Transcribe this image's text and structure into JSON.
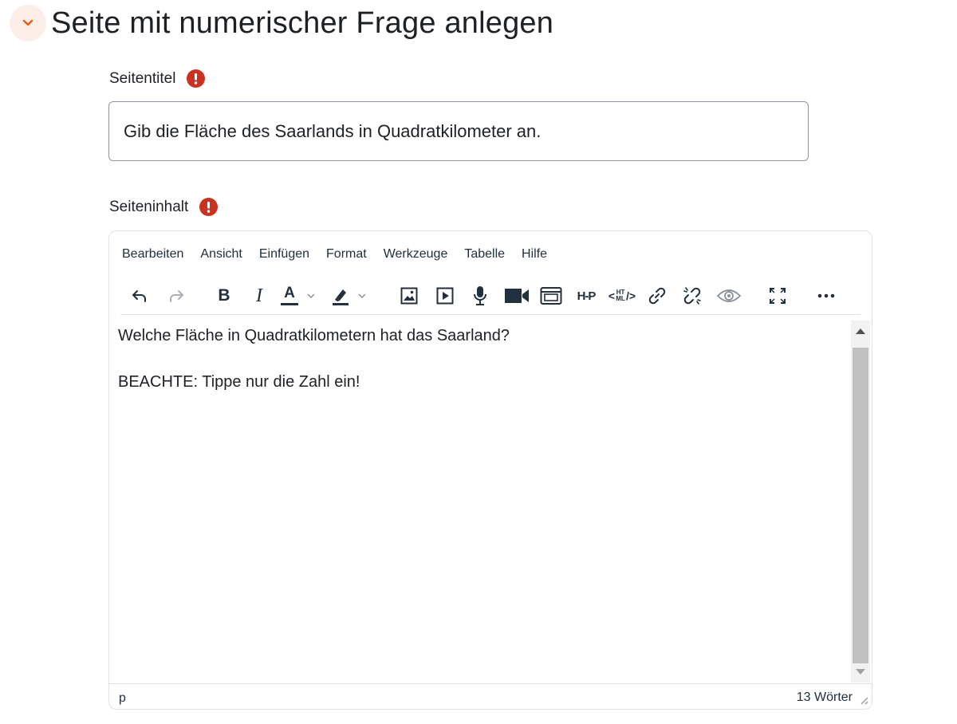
{
  "section": {
    "title": "Seite mit numerischer Frage anlegen",
    "collapse_icon": "chevron-down-icon",
    "accent_color": "#e4610f"
  },
  "form": {
    "title_label": "Seitentitel",
    "title_value": "Gib die Fläche des Saarlands in Quadratkilometer an.",
    "content_label": "Seiteninhalt",
    "required_icon": "exclamation-circle-icon",
    "required_color": "#ca3120"
  },
  "editor": {
    "menu": [
      "Bearbeiten",
      "Ansicht",
      "Einfügen",
      "Format",
      "Werkzeuge",
      "Tabelle",
      "Hilfe"
    ],
    "toolbar_icons": [
      "undo-icon",
      "redo-icon",
      "bold-icon",
      "italic-icon",
      "text-color-icon",
      "highlight-icon",
      "image-icon",
      "media-icon",
      "microphone-icon",
      "video-camera-icon",
      "embed-icon",
      "h5p-icon",
      "html-icon",
      "link-icon",
      "unlink-icon",
      "preview-icon",
      "fullscreen-icon",
      "more-icon"
    ],
    "toolbar_text": {
      "bold": "B",
      "italic": "I",
      "text_color": "A",
      "h5p": "H-P",
      "html": "HTML"
    },
    "content": [
      "Welche Fläche in Quadratkilometern hat das Saarland?",
      "",
      "BEACHTE: Tippe nur die Zahl ein!"
    ],
    "path": "p",
    "word_count": "13 Wörter"
  }
}
